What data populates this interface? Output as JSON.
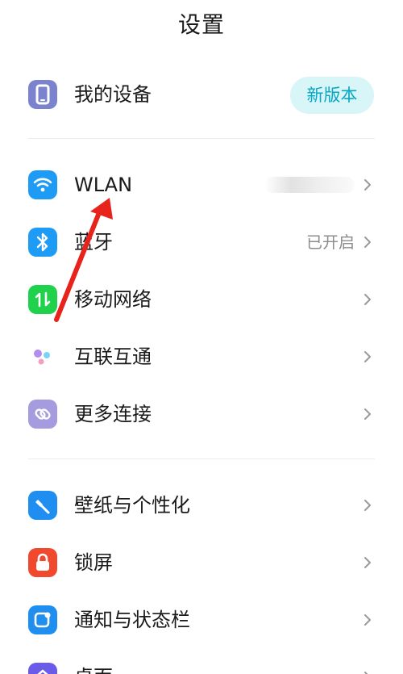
{
  "header": {
    "title": "设置"
  },
  "device": {
    "label": "我的设备",
    "badge": "新版本",
    "icon": "phone-icon"
  },
  "items": [
    {
      "label": "WLAN",
      "value": "",
      "icon": "wifi-icon",
      "color": "#1e9bf5"
    },
    {
      "label": "蓝牙",
      "value": "已开启",
      "icon": "bluetooth-icon",
      "color": "#1e9bf5"
    },
    {
      "label": "移动网络",
      "value": "",
      "icon": "mobile-network-icon",
      "color": "#1fd14b"
    },
    {
      "label": "互联互通",
      "value": "",
      "icon": "interconnect-icon",
      "color": "#b48cf0"
    },
    {
      "label": "更多连接",
      "value": "",
      "icon": "link-icon",
      "color": "#a59bdf"
    },
    {
      "label": "壁纸与个性化",
      "value": "",
      "icon": "personalize-icon",
      "color": "#1e8ff0"
    },
    {
      "label": "锁屏",
      "value": "",
      "icon": "lock-icon",
      "color": "#f0492e"
    },
    {
      "label": "通知与状态栏",
      "value": "",
      "icon": "notification-icon",
      "color": "#1e8ff0"
    },
    {
      "label": "桌面",
      "value": "",
      "icon": "home-icon",
      "color": "#6a5be8"
    }
  ],
  "annotation": {
    "arrow_color": "#e8231c"
  }
}
